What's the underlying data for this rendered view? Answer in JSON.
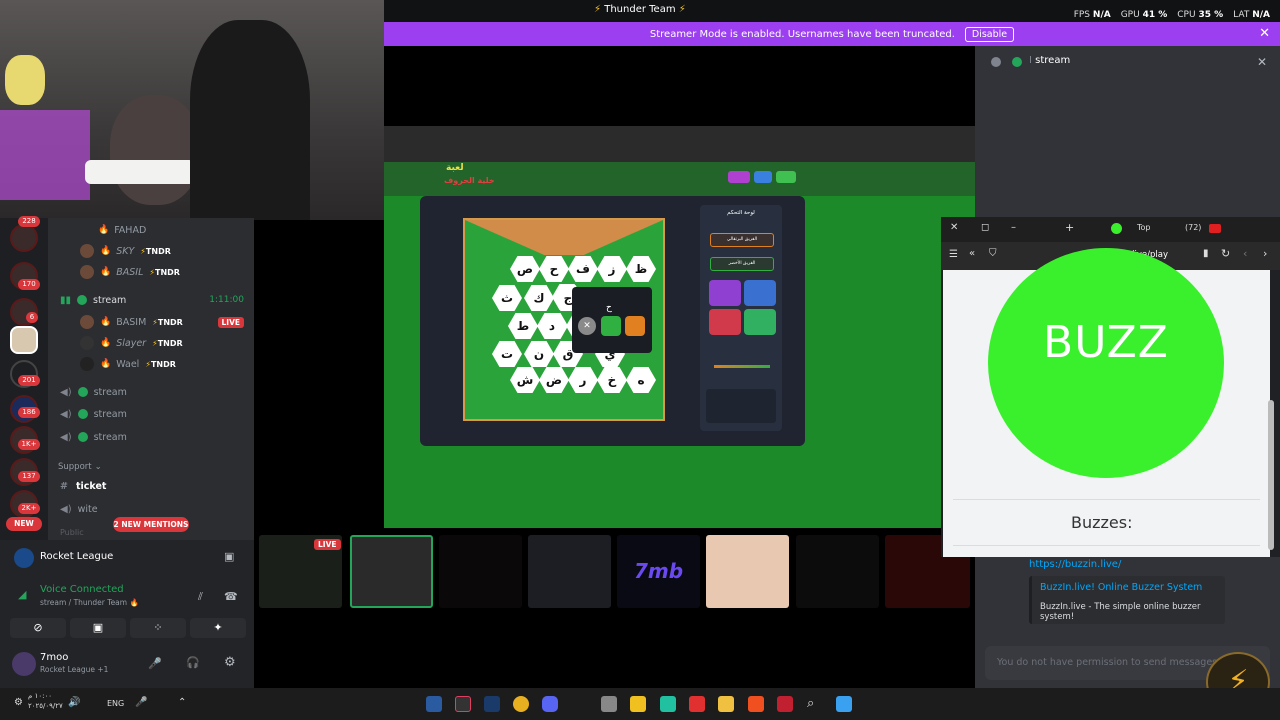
{
  "window": {
    "title": "Thunder Team",
    "title_icon": "bolt-icon"
  },
  "stats": [
    {
      "label": "FPS",
      "value": "N/A"
    },
    {
      "label": "GPU",
      "value": "41 %"
    },
    {
      "label": "CPU",
      "value": "35 %"
    },
    {
      "label": "LAT",
      "value": "N/A"
    }
  ],
  "banner": {
    "text": "Streamer Mode is enabled. Usernames have been truncated.",
    "button": "Disable",
    "color": "#9b3ff0"
  },
  "servers": {
    "badges": [
      "228",
      "170",
      "6",
      "201",
      "186",
      "1K+",
      "137",
      "2K+"
    ],
    "new_label": "NEW"
  },
  "channels": {
    "voice_members_top": [
      {
        "name": "FAHAD",
        "tag": ""
      },
      {
        "name": "SKY",
        "tag": "TNDR"
      },
      {
        "name": "BASIL",
        "tag": "TNDR"
      }
    ],
    "stream_channel": {
      "name": "stream",
      "timer": "1:11:00"
    },
    "stream_members": [
      {
        "name": "BASIM",
        "tag": "TNDR",
        "live": "LIVE"
      },
      {
        "name": "Slayer",
        "tag": "TNDR"
      },
      {
        "name": "Wael",
        "tag": "TNDR"
      }
    ],
    "other_voice": [
      "stream",
      "stream",
      "stream"
    ],
    "category": "Support",
    "text_channels": [
      "ticket",
      "wite"
    ],
    "mentions": "2 NEW MENTIONS",
    "public_label": "Public"
  },
  "activity": {
    "game": "Rocket League"
  },
  "voice": {
    "status": "Voice Connected",
    "channel": "stream / Thunder Team"
  },
  "user": {
    "name": "7moo",
    "status": "Rocket League +1"
  },
  "game": {
    "title_line1": "لعبة",
    "title_line2": "خلية الحروف",
    "board_letters": [
      [
        "ظ",
        "ز",
        "ف",
        "ح",
        "ص"
      ],
      [
        "ق",
        "ج",
        "ك",
        "ث"
      ],
      [
        "ل",
        "ن",
        "د",
        "ط"
      ],
      [
        "ي",
        "ق",
        "ن",
        "ت"
      ],
      [
        "ه",
        "خ",
        "ر",
        "ض",
        "ش"
      ]
    ],
    "popup_letter": "ح",
    "control_title": "لوحة التحكم",
    "team1": "الفريق البرتقالي",
    "team2": "الفريق الأخضر"
  },
  "strip": {
    "live": "LIVE",
    "tiles": [
      "",
      "",
      "",
      "",
      "7mb",
      "",
      "",
      ""
    ]
  },
  "right_panel": {
    "channel_header": "stream",
    "link": "https://buzzin.live/",
    "embed_title": "BuzzIn.live! Online Buzzer System",
    "embed_desc": "BuzzIn.live - The simple online buzzer system!",
    "input_placeholder": "You do not have permission to send messages"
  },
  "browser": {
    "tab_label": "Top",
    "tab_count": "(72)",
    "url": "buzzin.live/play",
    "buzz_label": "BUZZ",
    "buzzes_label": "Buzzes:",
    "buzz_color": "#3af02c"
  },
  "taskbar": {
    "lang": "ENG",
    "time": "١٠:٠٠ م",
    "date": "٢٠٢٥/٠٩/٢٧"
  }
}
